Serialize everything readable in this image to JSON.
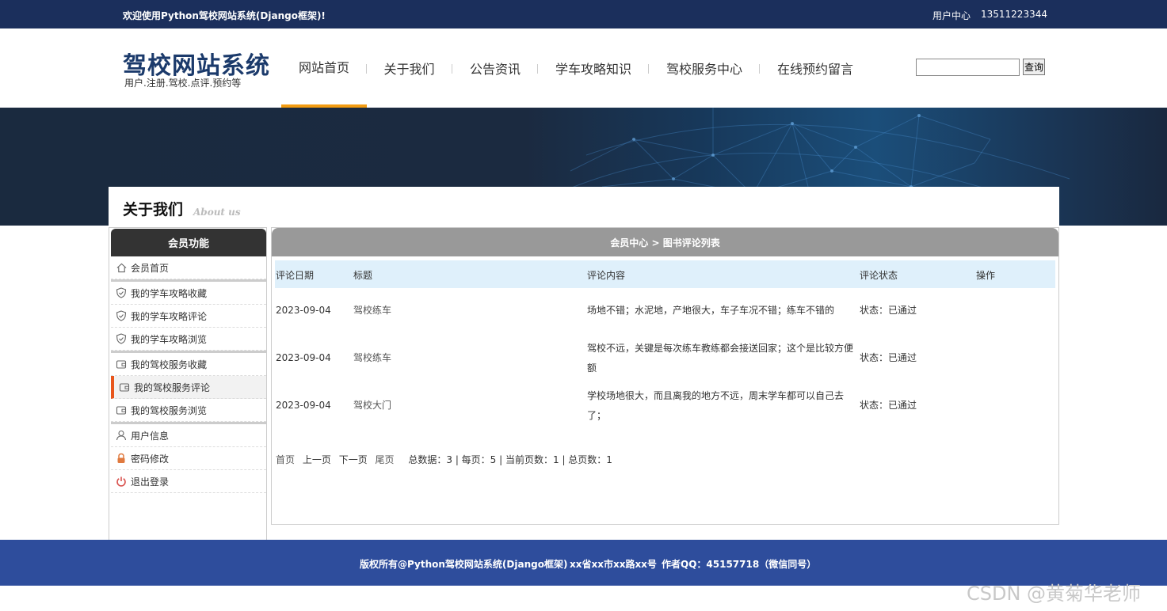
{
  "topbar": {
    "welcome": "欢迎使用Python驾校网站系统(Django框架)!",
    "user_center": "用户中心",
    "phone": "13511223344"
  },
  "header": {
    "logo_title": "驾校网站系统",
    "logo_subtitle": "用户.注册.驾校.点评.预约等",
    "nav": [
      {
        "label": "网站首页",
        "active": true
      },
      {
        "label": "关于我们",
        "active": false
      },
      {
        "label": "公告资讯",
        "active": false
      },
      {
        "label": "学车攻略知识",
        "active": false
      },
      {
        "label": "驾校服务中心",
        "active": false
      },
      {
        "label": "在线预约留言",
        "active": false
      }
    ],
    "search": {
      "value": "",
      "button": "查询"
    }
  },
  "page_heading": {
    "title": "关于我们",
    "subtitle_en": "About us"
  },
  "sidebar": {
    "title": "会员功能",
    "items": [
      {
        "label": "会员首页",
        "icon": "home-icon"
      },
      {
        "label": "我的学车攻略收藏",
        "icon": "shield-icon"
      },
      {
        "label": "我的学车攻略评论",
        "icon": "shield-icon"
      },
      {
        "label": "我的学车攻略浏览",
        "icon": "shield-icon"
      },
      {
        "label": "我的驾校服务收藏",
        "icon": "wallet-icon"
      },
      {
        "label": "我的驾校服务评论",
        "icon": "wallet-icon",
        "active": true
      },
      {
        "label": "我的驾校服务浏览",
        "icon": "wallet-icon"
      },
      {
        "label": "用户信息",
        "icon": "user-icon"
      },
      {
        "label": "密码修改",
        "icon": "lock-icon"
      },
      {
        "label": "退出登录",
        "icon": "power-icon"
      }
    ]
  },
  "main": {
    "breadcrumb": "会员中心 > 图书评论列表",
    "columns": [
      "评论日期",
      "标题",
      "评论内容",
      "评论状态",
      "操作"
    ],
    "rows": [
      {
        "date": "2023-09-04",
        "title": "驾校练车",
        "content": "场地不错；水泥地，产地很大，车子车况不错；练车不错的",
        "status": "状态：已通过"
      },
      {
        "date": "2023-09-04",
        "title": "驾校练车",
        "content": "驾校不远，关键是每次练车教练都会接送回家；这个是比较方便额",
        "status": "状态：已通过"
      },
      {
        "date": "2023-09-04",
        "title": "驾校大门",
        "content": "学校场地很大，而且离我的地方不远，周末学车都可以自己去了；",
        "status": "状态：已通过"
      }
    ],
    "pager": {
      "first": "首页",
      "prev": "上一页",
      "next": "下一页",
      "last": "尾页",
      "summary": "总数据：3 | 每页：5 | 当前页数：1 | 总页数：1"
    }
  },
  "footer": {
    "copyright": "版权所有@Python驾校网站系统(Django框架)",
    "address": "xx省xx市xx路xx号",
    "qq": "作者QQ：45157718（微信同号）"
  },
  "watermark": "CSDN @黄菊华老师",
  "colors": {
    "topbar": "#1b2f5c",
    "nav_active": "#f39c12",
    "footer": "#2e4d9c",
    "sidebar_active": "#e8561c"
  }
}
